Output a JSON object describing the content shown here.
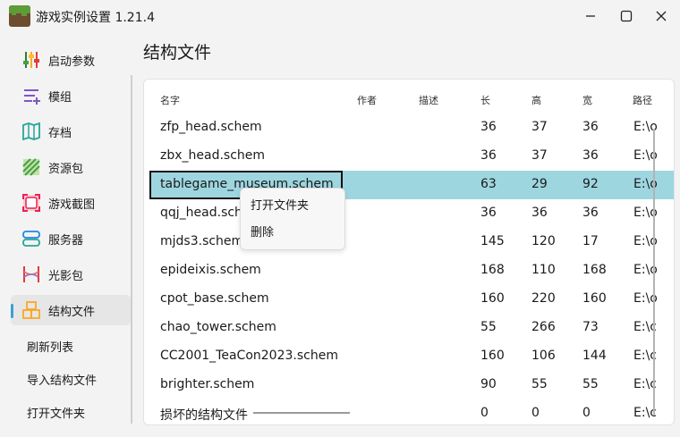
{
  "window": {
    "title": "游戏实例设置 1.21.4"
  },
  "sidebar": {
    "items": [
      {
        "label": "启动参数",
        "icon": "sliders-icon"
      },
      {
        "label": "模组",
        "icon": "mod-list-icon"
      },
      {
        "label": "存档",
        "icon": "map-icon"
      },
      {
        "label": "资源包",
        "icon": "resourcepack-icon"
      },
      {
        "label": "游戏截图",
        "icon": "screenshot-icon"
      },
      {
        "label": "服务器",
        "icon": "server-icon"
      },
      {
        "label": "光影包",
        "icon": "shader-icon"
      },
      {
        "label": "结构文件",
        "icon": "structure-icon",
        "active": true
      }
    ],
    "actions": [
      {
        "label": "刷新列表"
      },
      {
        "label": "导入结构文件"
      },
      {
        "label": "打开文件夹"
      }
    ]
  },
  "main": {
    "title": "结构文件",
    "columns": [
      "名字",
      "作者",
      "描述",
      "长",
      "高",
      "宽",
      "路径"
    ],
    "rows": [
      {
        "name": "zfp_head.schem",
        "author": "",
        "desc": "",
        "length": "36",
        "height": "37",
        "width": "36",
        "path": "E:\\o"
      },
      {
        "name": "zbx_head.schem",
        "author": "",
        "desc": "",
        "length": "36",
        "height": "37",
        "width": "36",
        "path": "E:\\o"
      },
      {
        "name": "tablegame_museum.schem",
        "author": "",
        "desc": "",
        "length": "63",
        "height": "29",
        "width": "92",
        "path": "E:\\o"
      },
      {
        "name": "qqj_head.schem",
        "author": "",
        "desc": "",
        "length": "36",
        "height": "36",
        "width": "36",
        "path": "E:\\o"
      },
      {
        "name": "mjds3.schem",
        "author": "",
        "desc": "",
        "length": "145",
        "height": "120",
        "width": "17",
        "path": "E:\\o"
      },
      {
        "name": "epideixis.schem",
        "author": "",
        "desc": "",
        "length": "168",
        "height": "110",
        "width": "168",
        "path": "E:\\o"
      },
      {
        "name": "cpot_base.schem",
        "author": "",
        "desc": "",
        "length": "160",
        "height": "220",
        "width": "160",
        "path": "E:\\o"
      },
      {
        "name": "chao_tower.schem",
        "author": "",
        "desc": "",
        "length": "55",
        "height": "266",
        "width": "73",
        "path": "E:\\c"
      },
      {
        "name": "CC2001_TeaCon2023.schem",
        "author": "",
        "desc": "",
        "length": "160",
        "height": "106",
        "width": "144",
        "path": "E:\\c"
      },
      {
        "name": "brighter.schem",
        "author": "",
        "desc": "",
        "length": "90",
        "height": "55",
        "width": "55",
        "path": "E:\\c"
      },
      {
        "name": "损坏的结构文件",
        "author": "",
        "desc": "",
        "length": "0",
        "height": "0",
        "width": "0",
        "path": "E:\\c"
      }
    ]
  },
  "context_menu": {
    "items": [
      {
        "label": "打开文件夹"
      },
      {
        "label": "删除"
      }
    ]
  }
}
